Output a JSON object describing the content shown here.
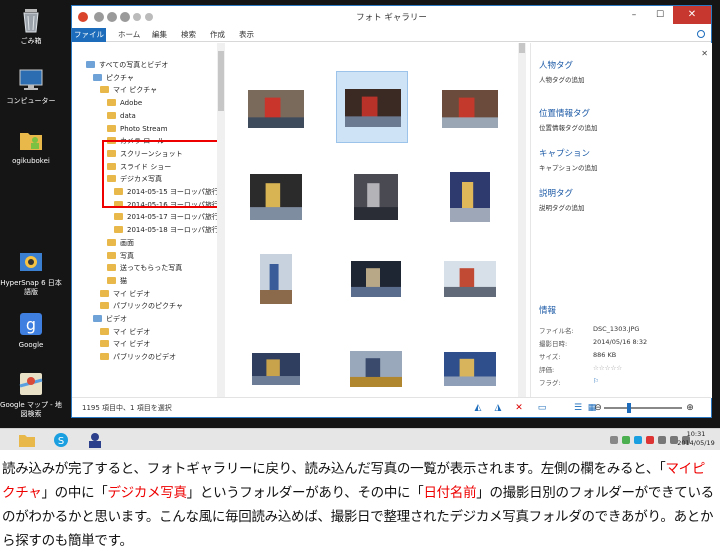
{
  "desktop_icons": [
    {
      "label": "ごみ箱",
      "icon": "recycle-bin-icon"
    },
    {
      "label": "コンピューター",
      "icon": "computer-icon"
    },
    {
      "label": "ogikubokei",
      "icon": "user-folder-icon"
    },
    {
      "label": "HyperSnap 6 日本語版",
      "icon": "hypersnap-icon"
    },
    {
      "label": "Google",
      "icon": "google-icon"
    },
    {
      "label": "Google マップ - 地図検索",
      "icon": "google-maps-icon"
    }
  ],
  "window": {
    "title": "フォト ギャラリー",
    "ribbon_tabs": [
      "ファイル",
      "ホーム",
      "編集",
      "検索",
      "作成",
      "表示"
    ]
  },
  "tree": [
    {
      "label": "すべての写真とビデオ",
      "indent": 0,
      "kind": "root"
    },
    {
      "label": "ピクチャ",
      "indent": 1,
      "kind": "blue"
    },
    {
      "label": "マイ ピクチャ",
      "indent": 2,
      "kind": "folder"
    },
    {
      "label": "Adobe",
      "indent": 3,
      "kind": "folder"
    },
    {
      "label": "data",
      "indent": 3,
      "kind": "folder"
    },
    {
      "label": "Photo Stream",
      "indent": 3,
      "kind": "folder"
    },
    {
      "label": "カメラ ロール",
      "indent": 3,
      "kind": "folder"
    },
    {
      "label": "スクリーンショット",
      "indent": 3,
      "kind": "folder"
    },
    {
      "label": "スライド ショー",
      "indent": 3,
      "kind": "folder"
    },
    {
      "label": "デジカメ写真",
      "indent": 3,
      "kind": "folder"
    },
    {
      "label": "2014-05-15 ヨーロッパ旅行",
      "indent": 4,
      "kind": "folder"
    },
    {
      "label": "2014-05-16 ヨーロッパ旅行",
      "indent": 4,
      "kind": "folder"
    },
    {
      "label": "2014-05-17 ヨーロッパ旅行",
      "indent": 4,
      "kind": "folder"
    },
    {
      "label": "2014-05-18 ヨーロッパ旅行",
      "indent": 4,
      "kind": "folder"
    },
    {
      "label": "画面",
      "indent": 3,
      "kind": "folder"
    },
    {
      "label": "写真",
      "indent": 3,
      "kind": "folder"
    },
    {
      "label": "送ってもらった写真",
      "indent": 3,
      "kind": "folder"
    },
    {
      "label": "猫",
      "indent": 3,
      "kind": "folder"
    },
    {
      "label": "マイ ビデオ",
      "indent": 2,
      "kind": "folder"
    },
    {
      "label": "パブリックのピクチャ",
      "indent": 2,
      "kind": "folder"
    },
    {
      "label": "ビデオ",
      "indent": 1,
      "kind": "blue"
    },
    {
      "label": "マイ ビデオ",
      "indent": 2,
      "kind": "folder"
    },
    {
      "label": "マイ ビデオ",
      "indent": 2,
      "kind": "folder"
    },
    {
      "label": "パブリックのビデオ",
      "indent": 2,
      "kind": "folder"
    }
  ],
  "info_pane": {
    "sections": [
      {
        "heading": "人物タグ",
        "link": "人物タグの追加"
      },
      {
        "heading": "位置情報タグ",
        "link": "位置情報タグの追加"
      },
      {
        "heading": "キャプション",
        "link": "キャプションの追加"
      },
      {
        "heading": "説明タグ",
        "link": "説明タグの追加"
      }
    ],
    "details_heading": "情報",
    "details": [
      {
        "label": "ファイル名:",
        "value": "DSC_1303.JPG"
      },
      {
        "label": "撮影日時:",
        "value": "2014/05/16  8:32"
      },
      {
        "label": "サイズ:",
        "value": "886 KB"
      },
      {
        "label": "評価:",
        "value": "☆☆☆☆☆"
      },
      {
        "label": "フラグ:",
        "value": "⚐"
      }
    ]
  },
  "status": {
    "text": "1195 項目中、1 項目を選択"
  },
  "clock": {
    "time": "10:31",
    "date": "2014/05/19"
  },
  "caption": {
    "p1": "読み込みが完了すると、フォトギャラリーに戻り、読み込んだ写真の一覧が表示されます。左側の欄をみると、「",
    "r1": "マイピクチャ",
    "p2": "」の中に「",
    "r2": "デジカメ写真",
    "p3": "」というフォルダーがあり、その中に「",
    "r3": "日付名前",
    "p4": "」の撮影日別のフォルダーができているのがわかるかと思います。こんな風に毎回読み込めば、撮影日で整理されたデジカメ写真フォルダのできあがり。あとから探すのも簡単です。"
  },
  "colors": {
    "accent": "#1c6cbb",
    "highlight": "#e00000",
    "close": "#c7372f"
  }
}
